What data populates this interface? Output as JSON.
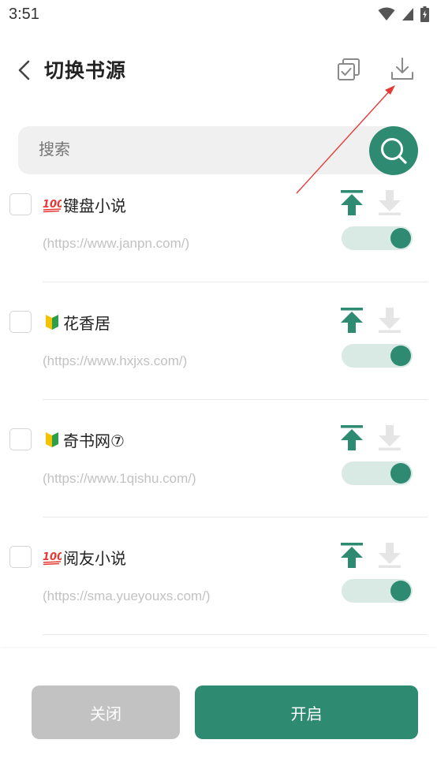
{
  "status_bar": {
    "time": "3:51"
  },
  "header": {
    "title": "切换书源"
  },
  "search": {
    "placeholder": "搜索"
  },
  "sources": [
    {
      "badge": "100",
      "name": "键盘小说",
      "url": "(https://www.janpn.com/)",
      "enabled": true,
      "checked": false
    },
    {
      "badge": "beginner",
      "name": "花香居",
      "url": "(https://www.hxjxs.com/)",
      "enabled": true,
      "checked": false
    },
    {
      "badge": "beginner",
      "name": "奇书网⑦",
      "url": "(https://www.1qishu.com/)",
      "enabled": true,
      "checked": false
    },
    {
      "badge": "100",
      "name": "阅友小说",
      "url": "(https://sma.yueyouxs.com/)",
      "enabled": true,
      "checked": false
    }
  ],
  "footer": {
    "close_label": "关闭",
    "open_label": "开启"
  },
  "colors": {
    "accent": "#2f8a72",
    "toggle_track": "#d9e9e4",
    "disabled_button": "#c2c2c2",
    "annotation_arrow": "#e53935"
  }
}
